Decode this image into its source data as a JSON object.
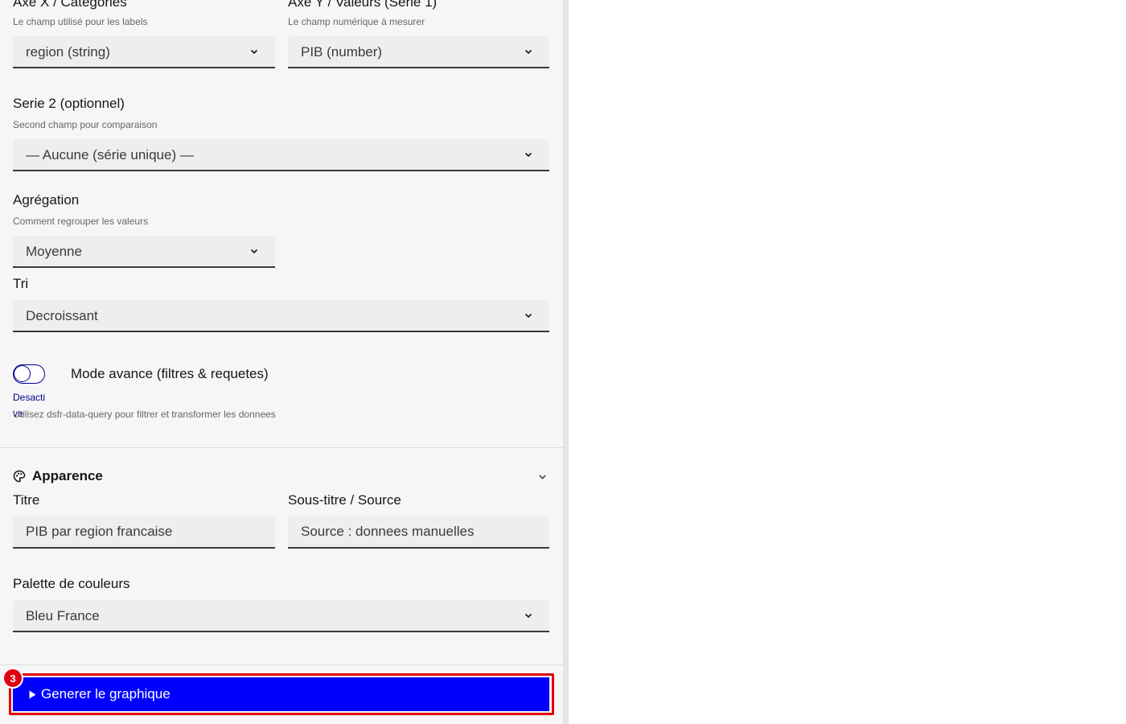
{
  "fields": {
    "x_axis": {
      "label": "Axe X / Categories",
      "hint": "Le champ utilisé pour les labels",
      "value": "region (string)"
    },
    "y_axis": {
      "label": "Axe Y / Valeurs (Serie 1)",
      "hint": "Le champ numérique à mesurer",
      "value": "PIB (number)"
    },
    "serie2": {
      "label": "Serie 2 (optionnel)",
      "hint": "Second champ pour comparaison",
      "value": "— Aucune (série unique) —"
    },
    "aggregation": {
      "label": "Agrégation",
      "hint": "Comment regrouper les valeurs",
      "value": "Moyenne"
    },
    "sort": {
      "label": "Tri",
      "value": "Decroissant"
    }
  },
  "advanced": {
    "label": "Mode avance (filtres & requetes)",
    "state": "Desactive",
    "hint": "Utilisez dsfr-data-query pour filtrer et transformer les donnees"
  },
  "appearance": {
    "section_title": "Apparence",
    "title_field": {
      "label": "Titre",
      "value": "PIB par region francaise"
    },
    "subtitle_field": {
      "label": "Sous-titre / Source",
      "value": "Source : donnees manuelles"
    },
    "palette": {
      "label": "Palette de couleurs",
      "value": "Bleu France"
    }
  },
  "generate": {
    "label": "Generer le graphique",
    "badge": "3"
  },
  "colors": {
    "primary": "#000091",
    "button": "#0000ff",
    "highlight": "#e1000f"
  }
}
